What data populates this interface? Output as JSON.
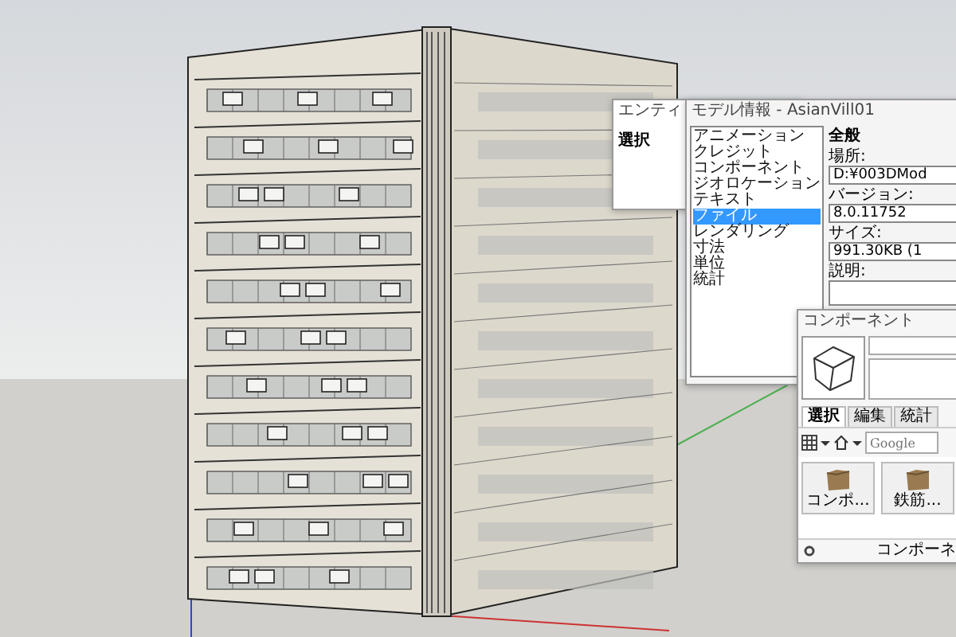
{
  "entity_info": {
    "title": "エンティ",
    "label": "選択"
  },
  "model_info": {
    "title": "モデル情報 - AsianVill01",
    "sidebar": {
      "items": [
        {
          "label": "アニメーション",
          "selected": false
        },
        {
          "label": "クレジット",
          "selected": false
        },
        {
          "label": "コンポーネント",
          "selected": false
        },
        {
          "label": "ジオロケーション",
          "selected": false
        },
        {
          "label": "テキスト",
          "selected": false
        },
        {
          "label": "ファイル",
          "selected": true
        },
        {
          "label": "レンダリング",
          "selected": false
        },
        {
          "label": "寸法",
          "selected": false
        },
        {
          "label": "単位",
          "selected": false
        },
        {
          "label": "統計",
          "selected": false
        }
      ]
    },
    "section_title": "全般",
    "fields": [
      {
        "kind": "text",
        "label": "場所:",
        "value": "D:¥003DMod"
      },
      {
        "kind": "text",
        "label": "バージョン:",
        "value": "8.0.11752"
      },
      {
        "kind": "text",
        "label": "サイズ:",
        "value": "991.30KB (1"
      },
      {
        "kind": "textarea",
        "label": "説明:"
      }
    ]
  },
  "components": {
    "title": "コンポーネント",
    "tabs": [
      {
        "label": "選択",
        "selected": true
      },
      {
        "label": "編集",
        "selected": false
      },
      {
        "label": "統計",
        "selected": false
      }
    ],
    "search": {
      "placeholder": "Google"
    },
    "items": [
      {
        "label": "コンポ..."
      },
      {
        "label": "鉄筋..."
      }
    ],
    "status": "コンポーネ"
  }
}
